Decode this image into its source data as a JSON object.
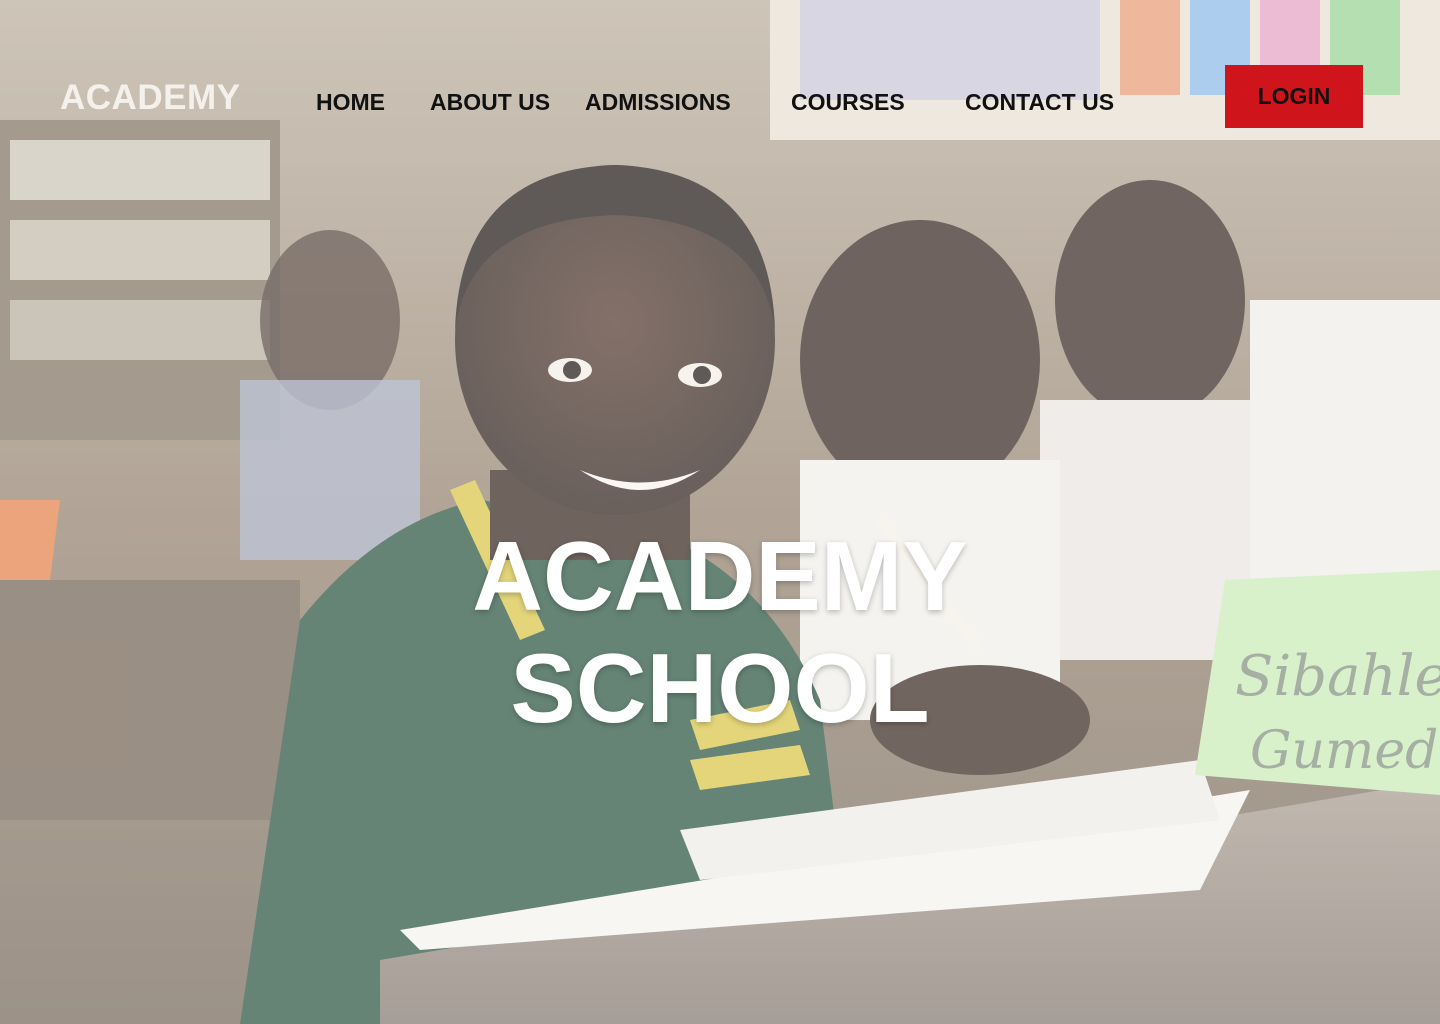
{
  "header": {
    "logo_text": "ACADEMY",
    "nav": [
      {
        "label": "HOME"
      },
      {
        "label": "ABOUT US"
      },
      {
        "label": "ADMISSIONS"
      },
      {
        "label": "COURSES"
      },
      {
        "label": "CONTACT US"
      }
    ],
    "login_label": "LOGIN"
  },
  "hero": {
    "title_line1": "ACADEMY",
    "title_line2": "SCHOOL",
    "background_image": "classroom-students-photo",
    "name_card_text_line1": "Sibahle",
    "name_card_text_line2": "Gumede"
  },
  "colors": {
    "login_button": "#d0141c",
    "nav_text": "#111111",
    "logo_text": "#f4f1ec",
    "hero_text": "#ffffff"
  }
}
